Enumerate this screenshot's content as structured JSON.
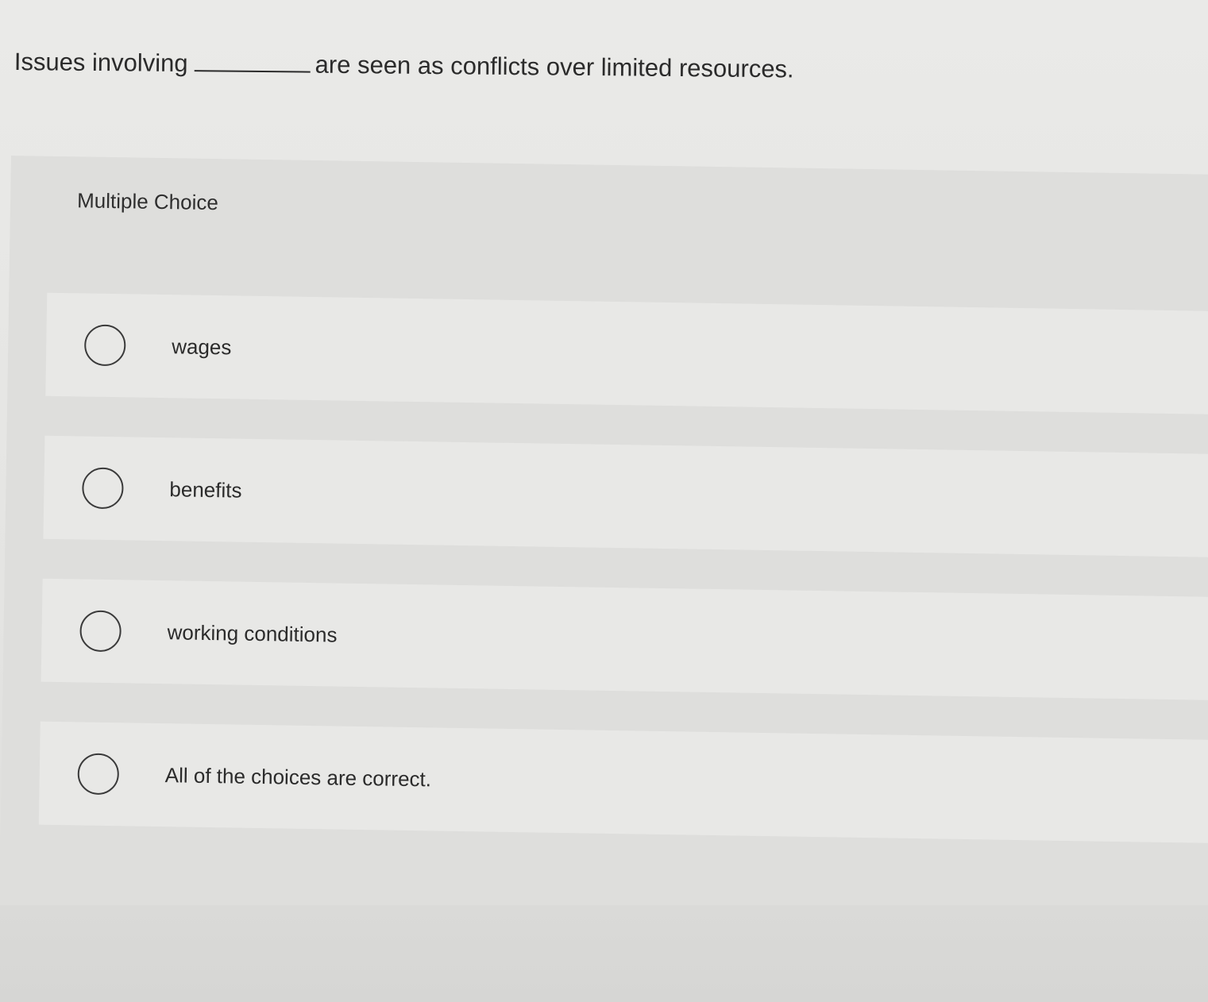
{
  "question": {
    "before_blank": "Issues involving",
    "after_blank": "are seen as conflicts over limited resources."
  },
  "multiple_choice": {
    "label": "Multiple Choice",
    "options": [
      {
        "label": "wages",
        "selected": false
      },
      {
        "label": "benefits",
        "selected": false
      },
      {
        "label": "working conditions",
        "selected": false
      },
      {
        "label": "All of the choices are correct.",
        "selected": false
      }
    ]
  }
}
